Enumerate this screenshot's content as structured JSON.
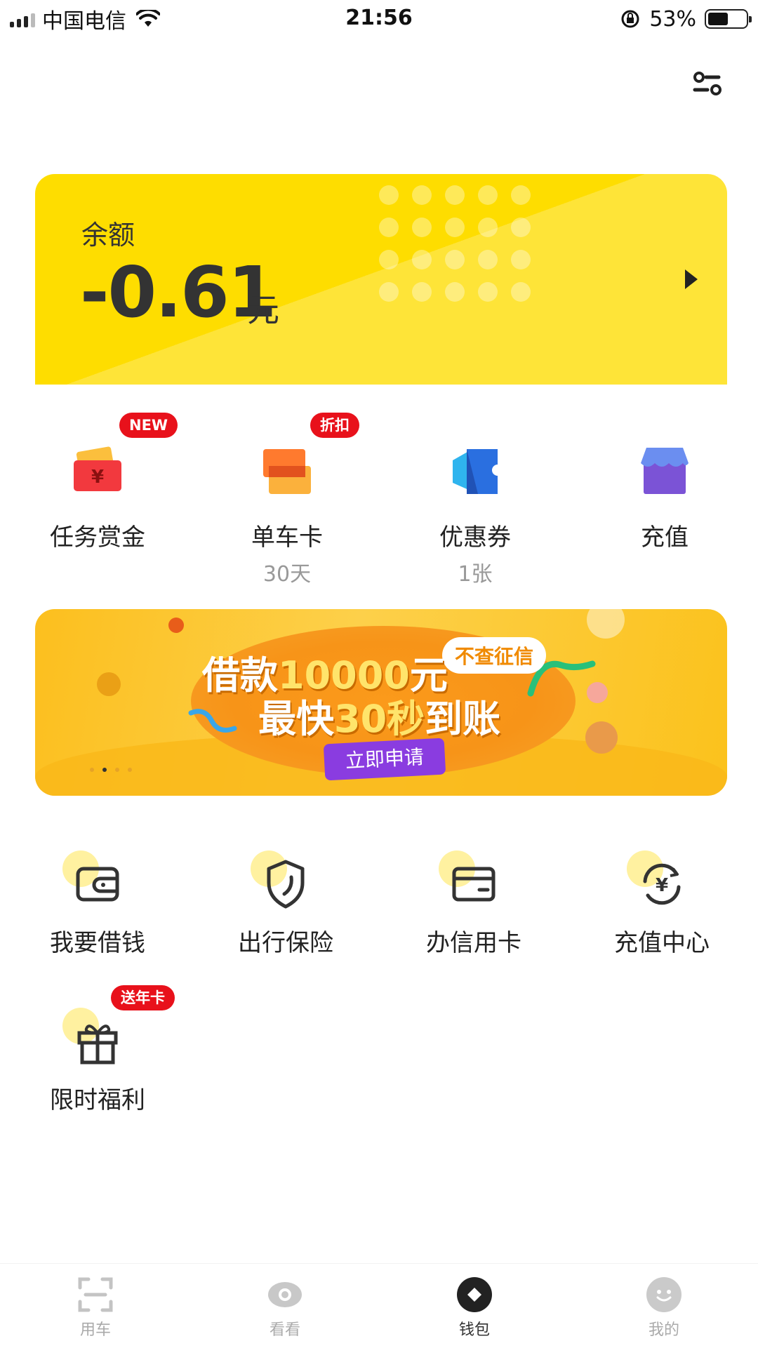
{
  "status_bar": {
    "carrier": "中国电信",
    "time": "21:56",
    "battery_percent": "53%",
    "battery_level": 0.53
  },
  "balance": {
    "label": "余额",
    "value": "-0.61",
    "unit": "元"
  },
  "quick_actions": [
    {
      "label": "任务赏金",
      "sub": "",
      "badge": "NEW",
      "icon": "red-envelope-icon"
    },
    {
      "label": "单车卡",
      "sub": "30天",
      "badge": "折扣",
      "icon": "bike-card-icon"
    },
    {
      "label": "优惠券",
      "sub": "1张",
      "badge": "",
      "icon": "coupon-icon"
    },
    {
      "label": "充值",
      "sub": "",
      "badge": "",
      "icon": "store-icon"
    }
  ],
  "banner": {
    "line1_a": "借款",
    "line1_b": "10000",
    "line1_c": "元",
    "line2_a": "最快",
    "line2_b": "30秒",
    "line2_c": "到账",
    "bubble": "不查征信",
    "button": "立即申请",
    "page_count": 4,
    "active_page": 2
  },
  "services": [
    {
      "label": "我要借钱",
      "icon": "wallet-icon"
    },
    {
      "label": "出行保险",
      "icon": "shield-icon"
    },
    {
      "label": "办信用卡",
      "icon": "credit-card-icon"
    },
    {
      "label": "充值中心",
      "icon": "recharge-yuan-icon"
    },
    {
      "label": "限时福利",
      "icon": "gift-icon",
      "badge": "送年卡"
    }
  ],
  "tabs": [
    {
      "label": "用车",
      "icon": "scan-icon",
      "active": false
    },
    {
      "label": "看看",
      "icon": "eye-icon",
      "active": false
    },
    {
      "label": "钱包",
      "icon": "wallet-diamond-icon",
      "active": true
    },
    {
      "label": "我的",
      "icon": "smiley-icon",
      "active": false
    }
  ],
  "colors": {
    "brand_yellow": "#fedd00",
    "badge_red": "#e8111b",
    "banner_button": "#8a3ce0"
  }
}
